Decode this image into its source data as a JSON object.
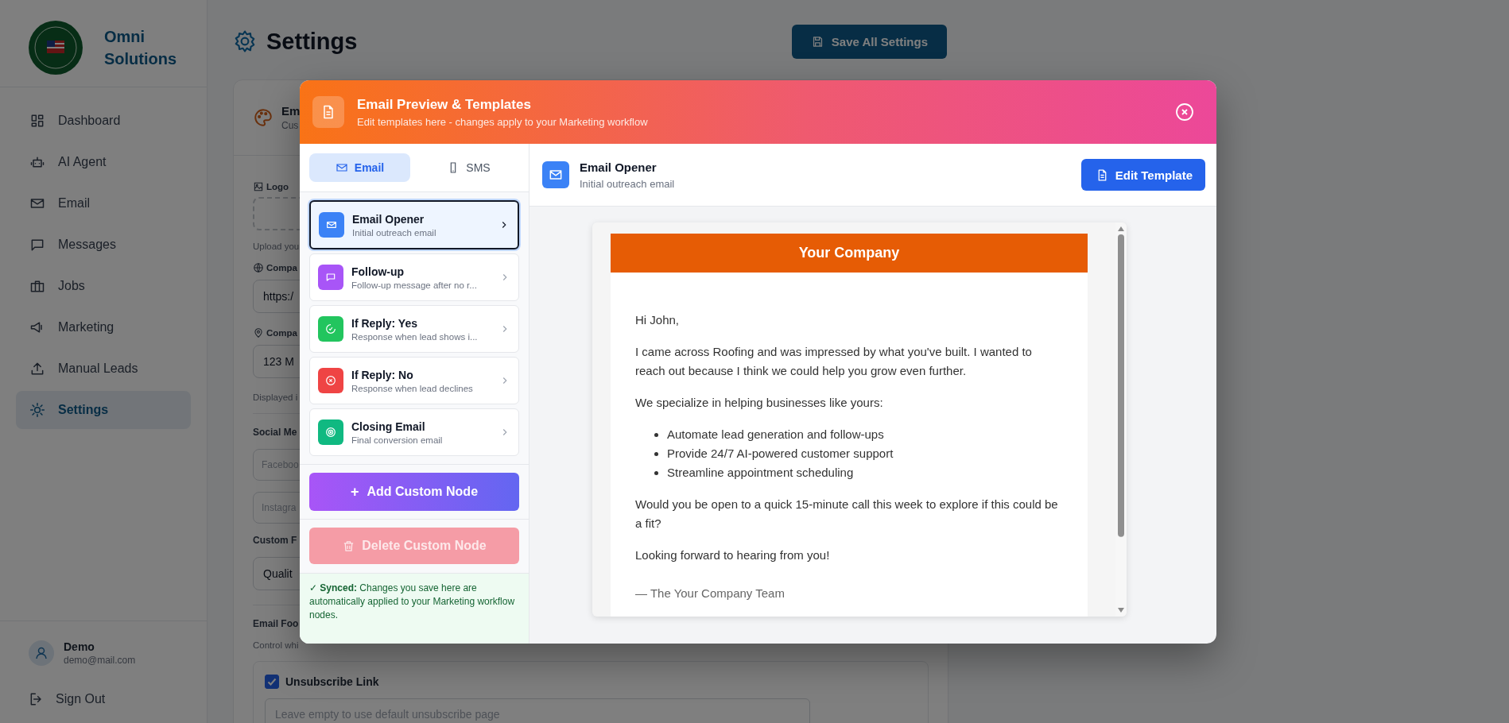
{
  "sidebar": {
    "brand_lines": [
      "Omni",
      "Solutions"
    ],
    "items": [
      {
        "label": "Dashboard",
        "selected": false
      },
      {
        "label": "AI Agent",
        "selected": false
      },
      {
        "label": "Email",
        "selected": false
      },
      {
        "label": "Messages",
        "selected": false
      },
      {
        "label": "Jobs",
        "selected": false
      },
      {
        "label": "Marketing",
        "selected": false
      },
      {
        "label": "Manual Leads",
        "selected": false
      },
      {
        "label": "Settings",
        "selected": true
      }
    ],
    "user": {
      "name": "Demo",
      "email": "demo@mail.com"
    },
    "sign_out": "Sign Out"
  },
  "page": {
    "title": "Settings",
    "save_button": "Save All Settings"
  },
  "settings_card": {
    "title": "Em",
    "subtitle": "Cus",
    "logo_label": "Logo",
    "logo_hint": "Upload you",
    "website_label": "Compa",
    "website_value": "https:/",
    "address_label": "Compa",
    "address_value": "123 M",
    "address_hint": "Displayed i",
    "social_label": "Social Me",
    "facebook_placeholder": "Faceboo",
    "instagram_placeholder": "Instagra",
    "custom_label": "Custom F",
    "custom_value": "Qualit",
    "footer_label": "Email Foo",
    "footer_hint": "Control whi",
    "unsubscribe": {
      "label": "Unsubscribe Link",
      "checked": true,
      "placeholder": "Leave empty to use default unsubscribe page"
    }
  },
  "modal": {
    "title": "Email Preview & Templates",
    "subtitle": "Edit templates here - changes apply to your Marketing workflow",
    "tabs": [
      {
        "label": "Email",
        "selected": true
      },
      {
        "label": "SMS",
        "selected": false
      }
    ],
    "templates": [
      {
        "name": "Email Opener",
        "description": "Initial outreach email",
        "color": "#3b82f6",
        "selected": true
      },
      {
        "name": "Follow-up",
        "description": "Follow-up message after no r...",
        "color": "#a855f7",
        "selected": false
      },
      {
        "name": "If Reply: Yes",
        "description": "Response when lead shows i...",
        "color": "#22c55e",
        "selected": false
      },
      {
        "name": "If Reply: No",
        "description": "Response when lead declines",
        "color": "#ef4444",
        "selected": false
      },
      {
        "name": "Closing Email",
        "description": "Final conversion email",
        "color": "#10b981",
        "selected": false
      }
    ],
    "add_button": "Add Custom Node",
    "add_symbol": "+",
    "delete_button": {
      "label": "Delete Custom Node",
      "disabled": true
    },
    "synced_note": "**Synced:** Changes you save here are automatically applied to your Marketing workflow nodes.",
    "synced_mark": "✓",
    "preview_header": {
      "title": "Email Opener",
      "subtitle": "Initial outreach email",
      "edit_button": "Edit Template"
    },
    "email": {
      "company": "Your Company",
      "greeting": "Hi John,",
      "paragraphs": [
        "I came across Roofing and was impressed by what you've built. I wanted to reach out because I think we could help you grow even further.",
        "We specialize in helping businesses like yours:"
      ],
      "bullets": [
        "Automate lead generation and follow-ups",
        "Provide 24/7 AI-powered customer support",
        "Streamline appointment scheduling"
      ],
      "closing_paragraphs": [
        "Would you be open to a quick 15-minute call this week to explore if this could be a fit?",
        "Looking forward to hearing from you!"
      ],
      "signature": "— The Your Company Team"
    }
  }
}
